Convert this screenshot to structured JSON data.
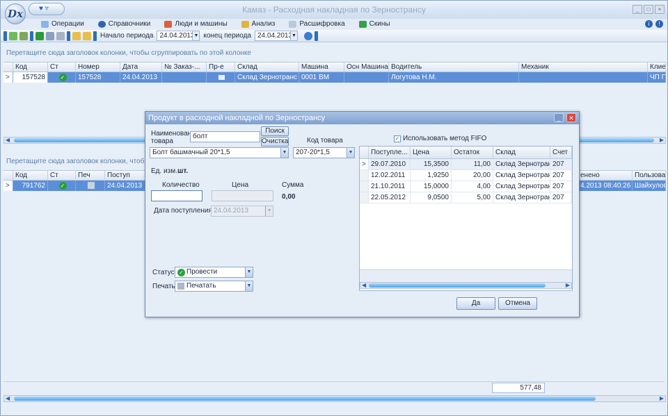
{
  "app": {
    "logo_text": "Dx",
    "title": "Камаз - Расходная накладная по Зерностранcу"
  },
  "window_buttons": [
    "_",
    "□",
    "×"
  ],
  "menu": {
    "items": [
      {
        "label": "Операции",
        "icon": "operations-icon"
      },
      {
        "label": "Справочники",
        "icon": "reference-icon"
      },
      {
        "label": "Люди и машины",
        "icon": "people-icon"
      },
      {
        "label": "Анализ",
        "icon": "analysis-icon"
      },
      {
        "label": "Расшифровка",
        "icon": "report-icon"
      },
      {
        "label": "Скины",
        "icon": "skins-icon"
      }
    ]
  },
  "toolbar": {
    "period_start_label": "Начало периода",
    "period_start": "24.04.2013",
    "period_end_label": "конец периода",
    "period_end": "24.04.2013"
  },
  "top_grid": {
    "group_hint": "Перетащите сюда заголовок колонки, чтобы сгруппировать по этой колонке",
    "columns": [
      "Код",
      "Ст",
      "Номер",
      "Дата",
      "№ Заказ-...",
      "Пр-е",
      "Склад",
      "Машина",
      "Осн Машина",
      "Водитель",
      "Механик",
      "Клиен"
    ],
    "row": {
      "kod": "157528",
      "nomer": "157528",
      "date": "24.04.2013",
      "sklad": "Склад Зернотранс",
      "mashina": "0001 ВМ",
      "voditel": "Логутова Н.М.",
      "client": "ЧП Пс"
    }
  },
  "bottom_grid": {
    "group_hint": "Перетащите сюда заголовок колонки, чтобы сгруппир",
    "columns": [
      "Код",
      "Ст",
      "Печ",
      "Поступ"
    ],
    "right_columns": [
      "енено",
      "Пользовате"
    ],
    "row": {
      "kod": "791762",
      "postup": "24.04.2013",
      "changed": "4.2013 08:40:26",
      "user": "Шайхулова"
    }
  },
  "footer": {
    "total": "577,48"
  },
  "dialog": {
    "title": "Продукт в расходной накладной по Зерностранcу",
    "name_label": "Наименование товара",
    "name_value": "болт",
    "search_button": "Поиск",
    "clear_button": "Очистка",
    "product_code_label": "Код товара",
    "product_select": "Болт башмачный  20*1,5",
    "product_code_select": "207-20*1,5",
    "unit_label": "Ед. изм.",
    "unit_value": "шт.",
    "qty_label": "Количество",
    "price_label": "Цена",
    "sum_label": "Сумма",
    "sum_value": "0,00",
    "date_label": "Дата поступления:",
    "date_value": "24.04.2013",
    "status_label": "Статус:",
    "status_value": "Провести",
    "print_label": "Печать:",
    "print_value": "Печатать",
    "fifo_label": "Использовать метод FIFO",
    "fifo_checked": "✓",
    "ok_button": "Да",
    "cancel_button": "Отмена",
    "stock": {
      "columns": [
        "Поступле...",
        "Цена",
        "Остаток",
        "Склад",
        "Счет"
      ],
      "rows": [
        {
          "date": "29.07.2010",
          "price": "15,3500",
          "rest": "11,00",
          "store": "Склад Зернотранс",
          "acct": "207"
        },
        {
          "date": "12.02.2011",
          "price": "1,9250",
          "rest": "20,00",
          "store": "Склад Зернотранс",
          "acct": "207"
        },
        {
          "date": "21.10.2011",
          "price": "15,0000",
          "rest": "4,00",
          "store": "Склад Зернотранс",
          "acct": "207"
        },
        {
          "date": "22.05.2012",
          "price": "9,0500",
          "rest": "5,00",
          "store": "Склад Зернотранс",
          "acct": "207"
        }
      ]
    }
  },
  "colors": {
    "accent": "#5c8fd8",
    "title_bar": "#7d9fd0"
  }
}
